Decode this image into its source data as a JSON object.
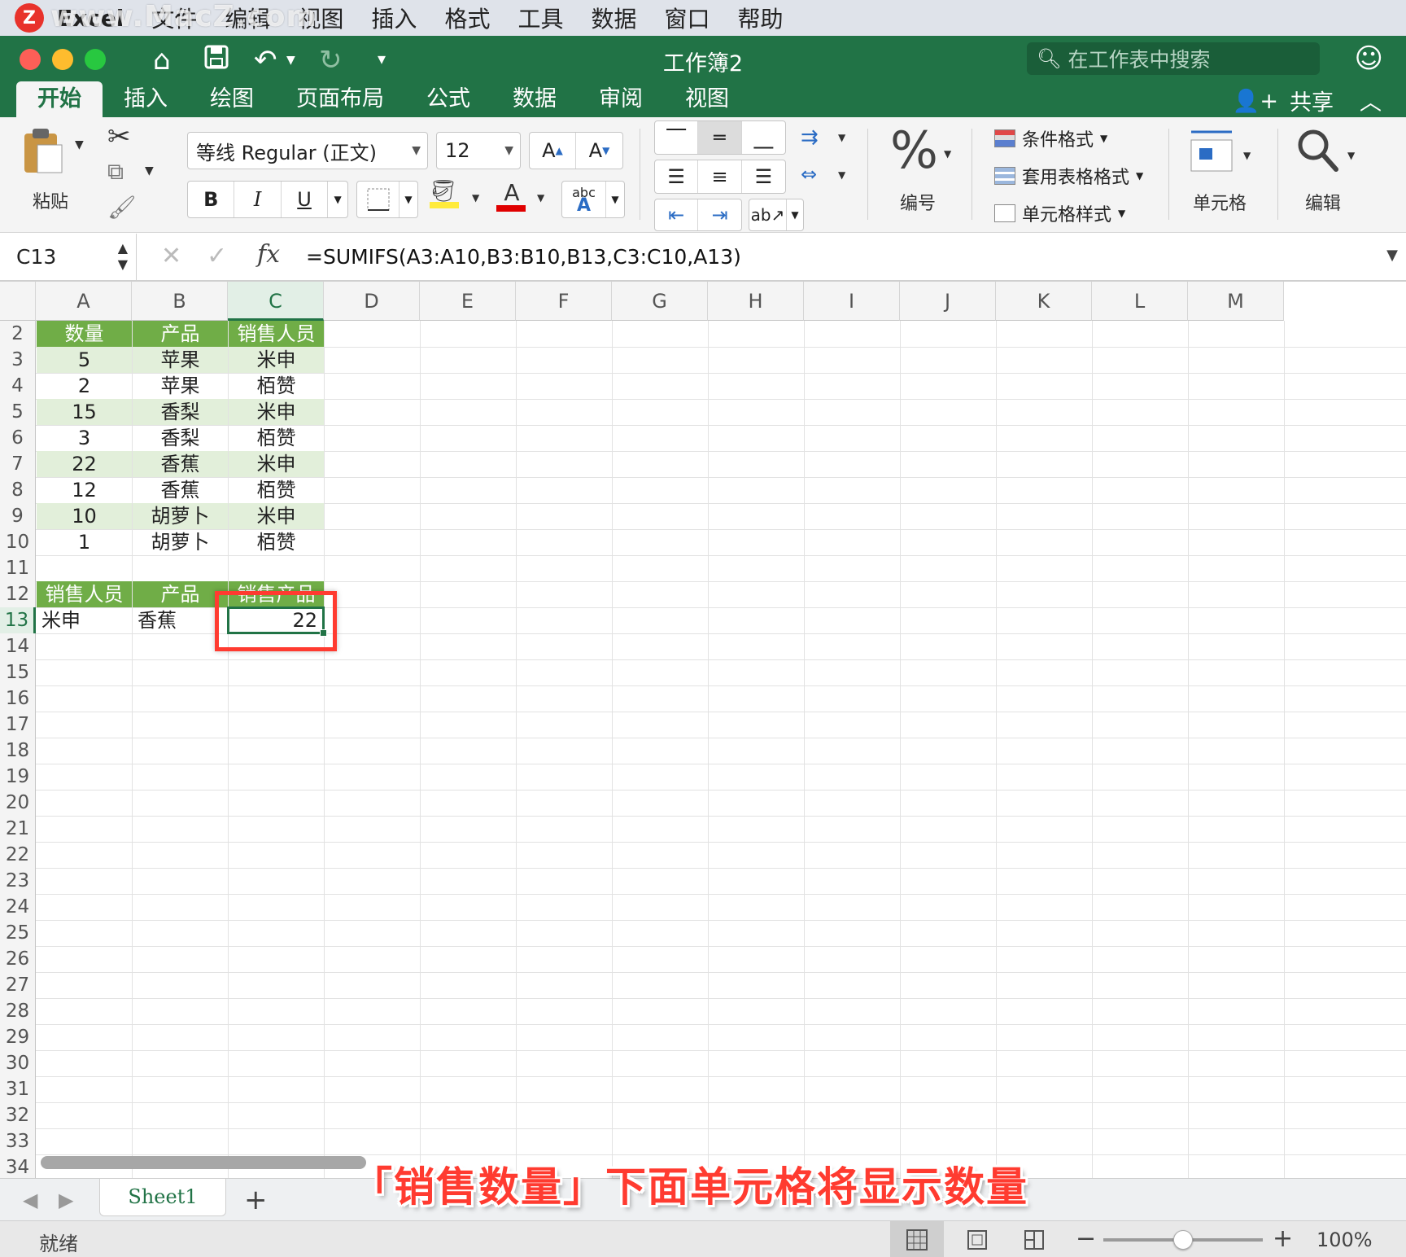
{
  "menubar": {
    "app_name": "Excel",
    "items": [
      "文件",
      "编辑",
      "视图",
      "插入",
      "格式",
      "工具",
      "数据",
      "窗口",
      "帮助"
    ],
    "watermark": "www.MacZ.com",
    "logo_letter": "Z"
  },
  "titlebar": {
    "title": "工作簿2",
    "search_placeholder": "在工作表中搜索",
    "share_label": "共享"
  },
  "tabs": [
    "开始",
    "插入",
    "绘图",
    "页面布局",
    "公式",
    "数据",
    "审阅",
    "视图"
  ],
  "active_tab": "开始",
  "ribbon": {
    "paste_label": "粘贴",
    "font_name": "等线 Regular (正文)",
    "font_size": "12",
    "bold": "B",
    "italic": "I",
    "underline": "U",
    "font_color_glyph": "A",
    "abc_glyph": "abc",
    "grow_font": "A",
    "shrink_font": "A",
    "number_glyph": "%",
    "number_label": "编号",
    "conditional_format": "条件格式",
    "table_format": "套用表格格式",
    "cell_styles": "单元格样式",
    "cells_label": "单元格",
    "editing_label": "编辑",
    "fill_color": "#ffeb3b",
    "font_color": "#e00000"
  },
  "formula_bar": {
    "name_box": "C13",
    "fx": "fx",
    "formula": "=SUMIFS(A3:A10,B3:B10,B13,C3:C10,A13)"
  },
  "grid": {
    "columns": [
      "A",
      "B",
      "C",
      "D",
      "E",
      "F",
      "G",
      "H",
      "I",
      "J",
      "K",
      "L",
      "M"
    ],
    "rows": [
      "2",
      "3",
      "4",
      "5",
      "6",
      "7",
      "8",
      "9",
      "10",
      "11",
      "12",
      "13",
      "14",
      "15",
      "16",
      "17",
      "18",
      "19",
      "20",
      "21",
      "22",
      "23",
      "24",
      "25",
      "26",
      "27",
      "28",
      "29",
      "30",
      "31",
      "32",
      "33",
      "34"
    ],
    "selected_column": "C",
    "selected_row": "13",
    "table_headers": [
      "数量",
      "产品",
      "销售人员"
    ],
    "table_rows": [
      [
        "5",
        "苹果",
        "米申"
      ],
      [
        "2",
        "苹果",
        "栢赞"
      ],
      [
        "15",
        "香梨",
        "米申"
      ],
      [
        "3",
        "香梨",
        "栢赞"
      ],
      [
        "22",
        "香蕉",
        "米申"
      ],
      [
        "12",
        "香蕉",
        "栢赞"
      ],
      [
        "10",
        "胡萝卜",
        "米申"
      ],
      [
        "1",
        "胡萝卜",
        "栢赞"
      ]
    ],
    "criteria_headers": [
      "销售人员",
      "产品",
      "销售产品"
    ],
    "criteria_row": [
      "米申",
      "香蕉",
      "22"
    ],
    "header_color": "#70ad47",
    "band_color": "#e2efda",
    "highlight_color": "#ff3b30"
  },
  "sheets": {
    "tabs": [
      "Sheet1"
    ],
    "add": "+"
  },
  "caption": "「销售数量」下面单元格将显示数量",
  "status": {
    "text": "就绪",
    "zoom": "100%",
    "zoom_fraction": 0.5
  }
}
